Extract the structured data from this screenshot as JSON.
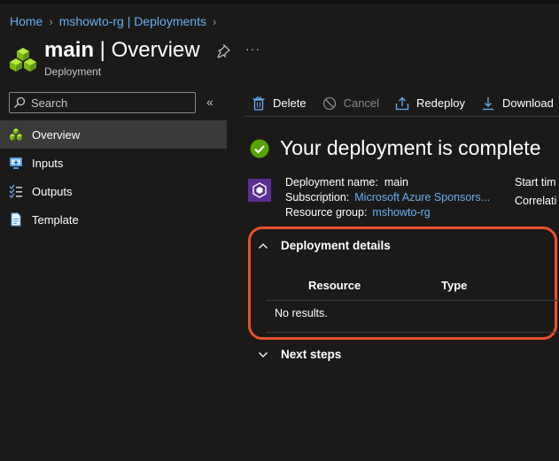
{
  "breadcrumb": [
    {
      "label": "Home"
    },
    {
      "label": "mshowto-rg | Deployments"
    }
  ],
  "header": {
    "title_bold": "main",
    "title_rest": " | Overview",
    "subtitle": "Deployment",
    "more": "···"
  },
  "search": {
    "placeholder": "Search",
    "collapse": "«"
  },
  "sidebar": {
    "items": [
      {
        "label": "Overview",
        "icon": "deployment-cubes-icon",
        "active": true
      },
      {
        "label": "Inputs",
        "icon": "inputs-icon"
      },
      {
        "label": "Outputs",
        "icon": "outputs-icon"
      },
      {
        "label": "Template",
        "icon": "template-icon"
      }
    ]
  },
  "toolbar": {
    "delete": "Delete",
    "cancel": "Cancel",
    "redeploy": "Redeploy",
    "download": "Download"
  },
  "status": {
    "text": "Your deployment is complete"
  },
  "deployment": {
    "name_label": "Deployment name:",
    "name_value": "main",
    "subscription_label": "Subscription:",
    "subscription_value": "Microsoft Azure Sponsors...",
    "rg_label": "Resource group:",
    "rg_value": "mshowto-rg",
    "start_label": "Start tim",
    "correlation_label": "Correlati"
  },
  "details": {
    "title": "Deployment details",
    "col_resource": "Resource",
    "col_type": "Type",
    "empty": "No results."
  },
  "next_steps": {
    "title": "Next steps"
  },
  "colors": {
    "background": "#1b1a19",
    "link": "#69aff5",
    "success": "#57a300",
    "highlight": "#e8512a",
    "active_nav": "#3b3a39"
  }
}
